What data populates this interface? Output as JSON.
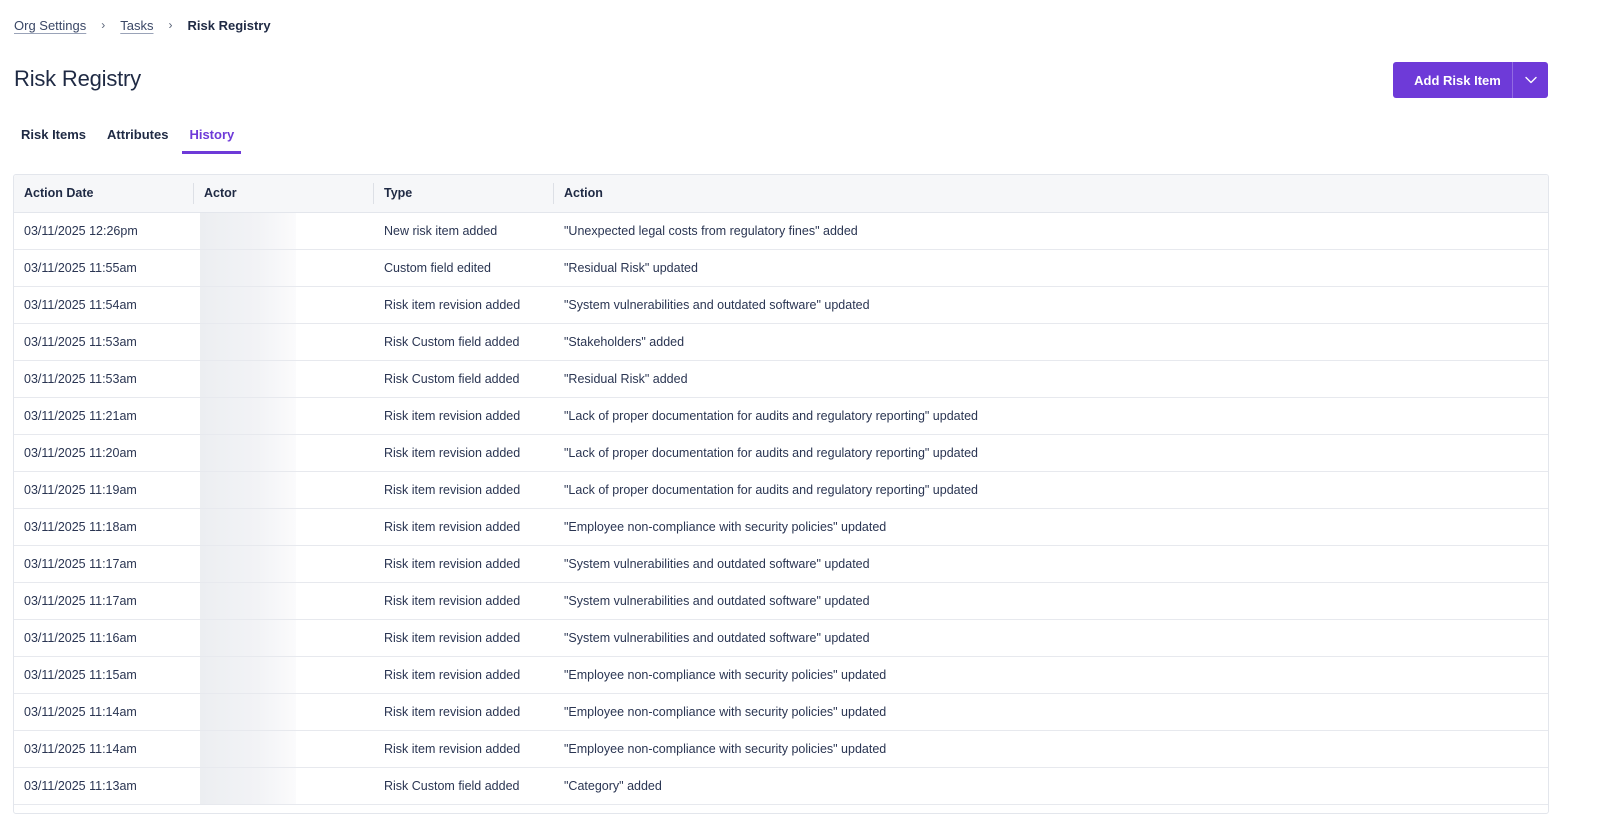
{
  "breadcrumb": {
    "items": [
      "Org Settings",
      "Tasks"
    ],
    "separator": "›",
    "current": "Risk Registry"
  },
  "page_title": "Risk Registry",
  "add_button": {
    "label": "Add Risk Item",
    "caret_icon": "chevron-down-icon",
    "color": "#6e3ad8"
  },
  "tabs": [
    {
      "label": "Risk Items",
      "active": false
    },
    {
      "label": "Attributes",
      "active": false
    },
    {
      "label": "History",
      "active": true
    }
  ],
  "accent_color": "#6e3ad8",
  "table": {
    "columns": [
      "Action Date",
      "Actor",
      "Type",
      "Action"
    ],
    "rows": [
      {
        "date": "03/11/2025 12:26pm",
        "type": "New risk item added",
        "action": "\"Unexpected legal costs from regulatory fines\" added"
      },
      {
        "date": "03/11/2025 11:55am",
        "type": "Custom field edited",
        "action": "\"Residual Risk\" updated"
      },
      {
        "date": "03/11/2025 11:54am",
        "type": "Risk item revision added",
        "action": "\"System vulnerabilities and outdated software\" updated"
      },
      {
        "date": "03/11/2025 11:53am",
        "type": "Risk Custom field added",
        "action": "\"Stakeholders\" added"
      },
      {
        "date": "03/11/2025 11:53am",
        "type": "Risk Custom field added",
        "action": "\"Residual Risk\" added"
      },
      {
        "date": "03/11/2025 11:21am",
        "type": "Risk item revision added",
        "action": "\"Lack of proper documentation for audits and regulatory reporting\" updated"
      },
      {
        "date": "03/11/2025 11:20am",
        "type": "Risk item revision added",
        "action": "\"Lack of proper documentation for audits and regulatory reporting\" updated"
      },
      {
        "date": "03/11/2025 11:19am",
        "type": "Risk item revision added",
        "action": "\"Lack of proper documentation for audits and regulatory reporting\" updated"
      },
      {
        "date": "03/11/2025 11:18am",
        "type": "Risk item revision added",
        "action": "\"Employee non-compliance with security policies\" updated"
      },
      {
        "date": "03/11/2025 11:17am",
        "type": "Risk item revision added",
        "action": "\"System vulnerabilities and outdated software\" updated"
      },
      {
        "date": "03/11/2025 11:17am",
        "type": "Risk item revision added",
        "action": "\"System vulnerabilities and outdated software\" updated"
      },
      {
        "date": "03/11/2025 11:16am",
        "type": "Risk item revision added",
        "action": "\"System vulnerabilities and outdated software\" updated"
      },
      {
        "date": "03/11/2025 11:15am",
        "type": "Risk item revision added",
        "action": "\"Employee non-compliance with security policies\" updated"
      },
      {
        "date": "03/11/2025 11:14am",
        "type": "Risk item revision added",
        "action": "\"Employee non-compliance with security policies\" updated"
      },
      {
        "date": "03/11/2025 11:14am",
        "type": "Risk item revision added",
        "action": "\"Employee non-compliance with security policies\" updated"
      },
      {
        "date": "03/11/2025 11:13am",
        "type": "Risk Custom field added",
        "action": "\"Category\" added"
      }
    ]
  }
}
